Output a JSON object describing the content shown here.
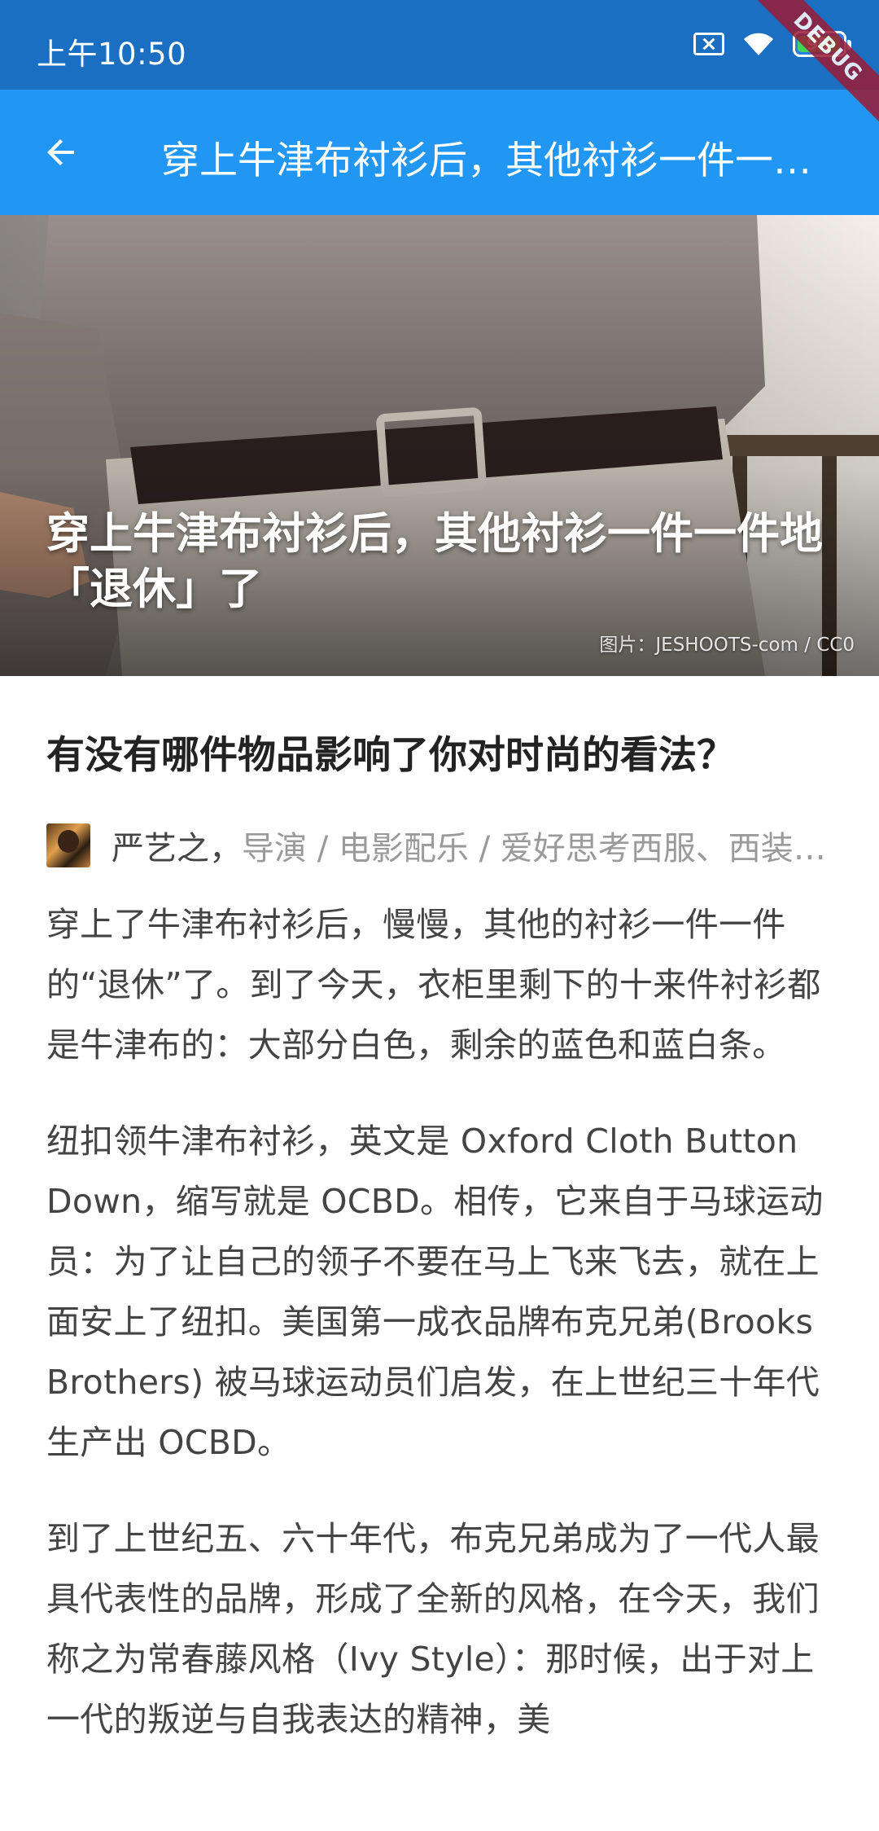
{
  "status_bar": {
    "time": "上午10:50",
    "battery_level": "95",
    "icons": [
      "sim-blocked-icon",
      "wifi-icon",
      "battery-icon"
    ]
  },
  "debug_banner": "DEBUG",
  "app_bar": {
    "back_icon": "arrow-left-icon",
    "title": "穿上牛津布衬衫后，其他衬衫一件一件地「退休」了",
    "background": "#2196f3"
  },
  "hero": {
    "title": "穿上牛津布衬衫后，其他衬衫一件一件地「退休」了",
    "credit": "图片：JESHOOTS-com / CC0"
  },
  "article": {
    "question": "有没有哪件物品影响了你对时尚的看法？",
    "author": {
      "name": "严艺之，",
      "bio": "导演 / 电影配乐 / 爱好思考西服、西装等穿搭话题"
    },
    "paragraphs": [
      "穿上了牛津布衬衫后，慢慢，其他的衬衫一件一件的“退休”了。到了今天，衣柜里剩下的十来件衬衫都是牛津布的：大部分白色，剩余的蓝色和蓝白条。",
      "纽扣领牛津布衬衫，英文是 Oxford Cloth Button Down，缩写就是 OCBD。相传，它来自于马球运动员：为了让自己的领子不要在马上飞来飞去，就在上面安上了纽扣。美国第一成衣品牌布克兄弟(Brooks Brothers) 被马球运动员们启发，在上世纪三十年代生产出 OCBD。",
      "到了上世纪五、六十年代，布克兄弟成为了一代人最具代表性的品牌，形成了全新的风格，在今天，我们称之为常春藤风格（Ivy Style）：那时候，出于对上一代的叛逆与自我表达的精神，美"
    ]
  }
}
